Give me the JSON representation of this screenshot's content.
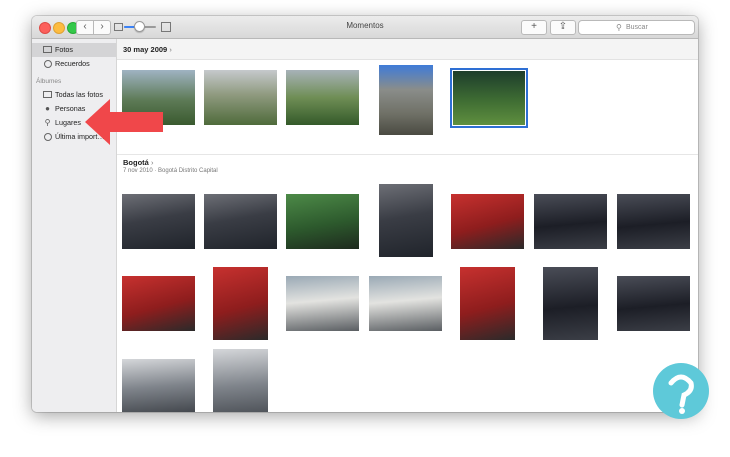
{
  "window": {
    "title": "Momentos"
  },
  "toolbar": {
    "back_label": "‹",
    "forward_label": "›",
    "add_label": "+",
    "share_label": "⇪",
    "search_placeholder": "Buscar",
    "zoom_level": 0.45
  },
  "sidebar": {
    "items": [
      {
        "label": "Fotos",
        "icon": "photos-icon",
        "selected": true
      },
      {
        "label": "Recuerdos",
        "icon": "memories-icon",
        "selected": false
      }
    ],
    "albums_header": "Álbumes",
    "albums": [
      {
        "label": "Todas las fotos",
        "icon": "all-photos-icon"
      },
      {
        "label": "Personas",
        "icon": "person-icon"
      },
      {
        "label": "Lugares",
        "icon": "pin-icon"
      },
      {
        "label": "Última import…",
        "icon": "clock-icon"
      }
    ]
  },
  "moments": [
    {
      "title": "30 may 2009",
      "chevron": "›",
      "subtitle": ""
    },
    {
      "title": "Bogotá",
      "chevron": "›",
      "subtitle": "7 nov 2010 · Bogotá Distrito Capital"
    }
  ],
  "colors": {
    "selection": "#2e6fd4",
    "annotation_arrow": "#f0474a",
    "sidebar_bg": "#eeeef0",
    "logo_circle": "#5ec9d9"
  }
}
